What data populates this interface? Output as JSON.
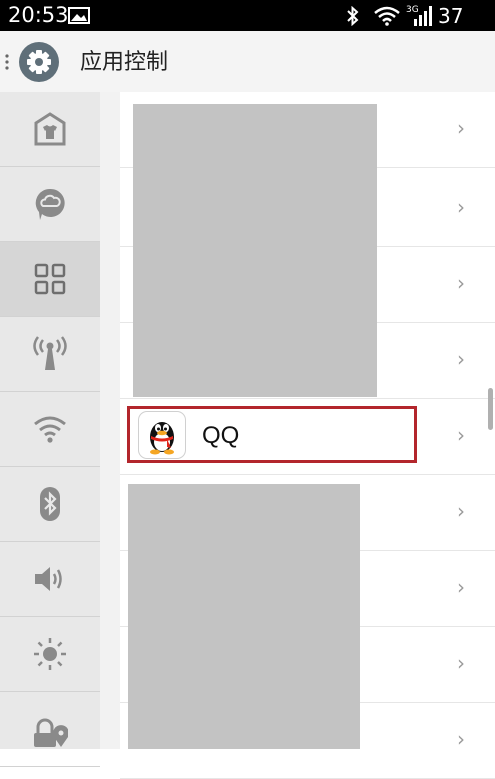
{
  "status_bar": {
    "time": "20:53",
    "network": "3G",
    "battery": "37"
  },
  "header": {
    "title": "应用控制"
  },
  "sidebar": {
    "items": [
      {
        "icon": "shirt-shield-icon"
      },
      {
        "icon": "cloud-bubble-icon"
      },
      {
        "icon": "app-grid-icon",
        "selected": true
      },
      {
        "icon": "antenna-icon"
      },
      {
        "icon": "wifi-icon"
      },
      {
        "icon": "bluetooth-icon"
      },
      {
        "icon": "volume-icon"
      },
      {
        "icon": "brightness-icon"
      },
      {
        "icon": "lock-location-icon"
      }
    ]
  },
  "app_list": {
    "items": [
      {
        "name": ""
      },
      {
        "name": ""
      },
      {
        "name": ""
      },
      {
        "name": ""
      },
      {
        "name": "QQ",
        "icon": "qq-penguin-icon",
        "highlighted": true
      },
      {
        "name": ""
      },
      {
        "name": ""
      },
      {
        "name": ""
      },
      {
        "name": ""
      }
    ]
  },
  "colors": {
    "highlight": "#b3262c",
    "redaction": "#c3c3c3",
    "sidebar": "#e8e8e8"
  }
}
